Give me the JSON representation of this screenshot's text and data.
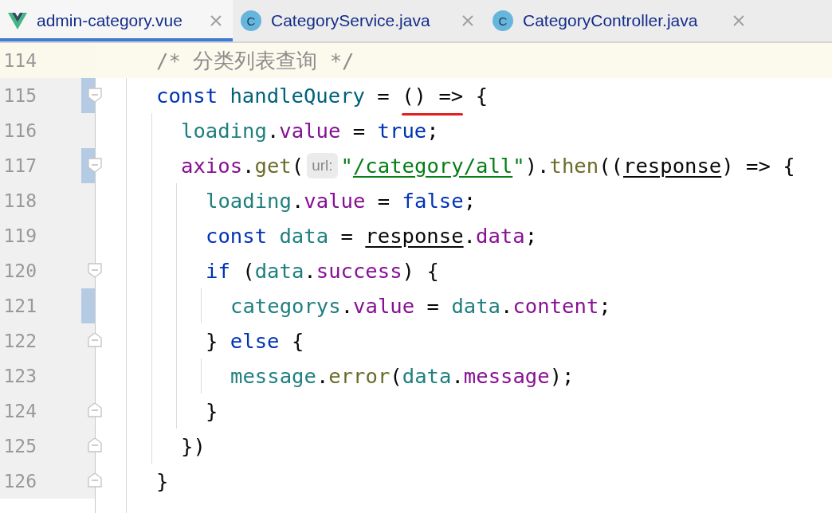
{
  "tabs": [
    {
      "label": "admin-category.vue",
      "kind": "vue",
      "selected": true
    },
    {
      "label": "CategoryService.java",
      "kind": "class",
      "badge": "C",
      "selected": false
    },
    {
      "label": "CategoryController.java",
      "kind": "class",
      "badge": "C",
      "selected": false
    }
  ],
  "lines": [
    {
      "number": "114",
      "current": true,
      "changed": false,
      "tokens": [
        {
          "text": "/* 分类列表查询 */",
          "kind": "comment"
        }
      ]
    },
    {
      "number": "115",
      "current": false,
      "changed": true,
      "fold_open": true,
      "tokens": [
        {
          "text": "const ",
          "kind": "keyword"
        },
        {
          "text": "handleQuery",
          "kind": "declaration"
        },
        {
          "text": " = ",
          "kind": "plain"
        },
        {
          "text": "() =>",
          "kind": "plain",
          "marked": true
        },
        {
          "text": " {",
          "kind": "plain"
        }
      ],
      "children": [
        {
          "number": "116",
          "current": false,
          "changed": false,
          "tokens": [
            {
              "text": "loading",
              "kind": "variable"
            },
            {
              "text": ".",
              "kind": "plain"
            },
            {
              "text": "value",
              "kind": "property"
            },
            {
              "text": " = ",
              "kind": "plain"
            },
            {
              "text": "true",
              "kind": "keyword"
            },
            {
              "text": ";",
              "kind": "plain"
            }
          ]
        },
        {
          "number": "117",
          "current": false,
          "changed": true,
          "fold_open": true,
          "tokens": [
            {
              "text": "axios",
              "kind": "property"
            },
            {
              "text": ".",
              "kind": "plain"
            },
            {
              "text": "get",
              "kind": "function"
            },
            {
              "text": "(",
              "kind": "plain"
            },
            {
              "text": "url:",
              "kind": "hint"
            },
            {
              "text": "\"",
              "kind": "string"
            },
            {
              "text": "/category/all",
              "kind": "link"
            },
            {
              "text": "\"",
              "kind": "string"
            },
            {
              "text": ").",
              "kind": "plain"
            },
            {
              "text": "then",
              "kind": "function"
            },
            {
              "text": "((",
              "kind": "plain"
            },
            {
              "text": "response",
              "kind": "parameter"
            },
            {
              "text": ") => {",
              "kind": "plain"
            }
          ],
          "children": [
            {
              "number": "118",
              "current": false,
              "changed": false,
              "tokens": [
                {
                  "text": "loading",
                  "kind": "variable"
                },
                {
                  "text": ".",
                  "kind": "plain"
                },
                {
                  "text": "value",
                  "kind": "property"
                },
                {
                  "text": " = ",
                  "kind": "plain"
                },
                {
                  "text": "false",
                  "kind": "keyword"
                },
                {
                  "text": ";",
                  "kind": "plain"
                }
              ]
            },
            {
              "number": "119",
              "current": false,
              "changed": false,
              "tokens": [
                {
                  "text": "const ",
                  "kind": "keyword"
                },
                {
                  "text": "data",
                  "kind": "variable"
                },
                {
                  "text": " = ",
                  "kind": "plain"
                },
                {
                  "text": "response",
                  "kind": "parameter"
                },
                {
                  "text": ".",
                  "kind": "plain"
                },
                {
                  "text": "data",
                  "kind": "property"
                },
                {
                  "text": ";",
                  "kind": "plain"
                }
              ]
            },
            {
              "number": "120",
              "current": false,
              "changed": false,
              "fold_open": true,
              "tokens": [
                {
                  "text": "if",
                  "kind": "keyword"
                },
                {
                  "text": " (",
                  "kind": "plain"
                },
                {
                  "text": "data",
                  "kind": "variable"
                },
                {
                  "text": ".",
                  "kind": "plain"
                },
                {
                  "text": "success",
                  "kind": "property"
                },
                {
                  "text": ") {",
                  "kind": "plain"
                }
              ],
              "children": [
                {
                  "number": "121",
                  "current": false,
                  "changed": true,
                  "tokens": [
                    {
                      "text": "categorys",
                      "kind": "variable"
                    },
                    {
                      "text": ".",
                      "kind": "plain"
                    },
                    {
                      "text": "value",
                      "kind": "property"
                    },
                    {
                      "text": " = ",
                      "kind": "plain"
                    },
                    {
                      "text": "data",
                      "kind": "variable"
                    },
                    {
                      "text": ".",
                      "kind": "plain"
                    },
                    {
                      "text": "content",
                      "kind": "property"
                    },
                    {
                      "text": ";",
                      "kind": "plain"
                    }
                  ]
                }
              ]
            },
            {
              "number": "122",
              "current": false,
              "changed": false,
              "fold_close": true,
              "tokens": [
                {
                  "text": "} ",
                  "kind": "plain"
                },
                {
                  "text": "else",
                  "kind": "keyword"
                },
                {
                  "text": " {",
                  "kind": "plain"
                }
              ],
              "children": [
                {
                  "number": "123",
                  "current": false,
                  "changed": false,
                  "tokens": [
                    {
                      "text": "message",
                      "kind": "variable"
                    },
                    {
                      "text": ".",
                      "kind": "plain"
                    },
                    {
                      "text": "error",
                      "kind": "function"
                    },
                    {
                      "text": "(",
                      "kind": "plain"
                    },
                    {
                      "text": "data",
                      "kind": "variable"
                    },
                    {
                      "text": ".",
                      "kind": "plain"
                    },
                    {
                      "text": "message",
                      "kind": "property"
                    },
                    {
                      "text": ");",
                      "kind": "plain"
                    }
                  ]
                }
              ]
            },
            {
              "number": "124",
              "current": false,
              "changed": false,
              "fold_close": true,
              "tokens": [
                {
                  "text": "}",
                  "kind": "plain"
                }
              ]
            }
          ]
        },
        {
          "number": "125",
          "current": false,
          "changed": false,
          "fold_close": true,
          "tokens": [
            {
              "text": "})",
              "kind": "plain"
            }
          ]
        }
      ]
    },
    {
      "number": "126",
      "current": false,
      "changed": false,
      "fold_close": true,
      "tokens": [
        {
          "text": "}",
          "kind": "plain"
        }
      ]
    }
  ]
}
